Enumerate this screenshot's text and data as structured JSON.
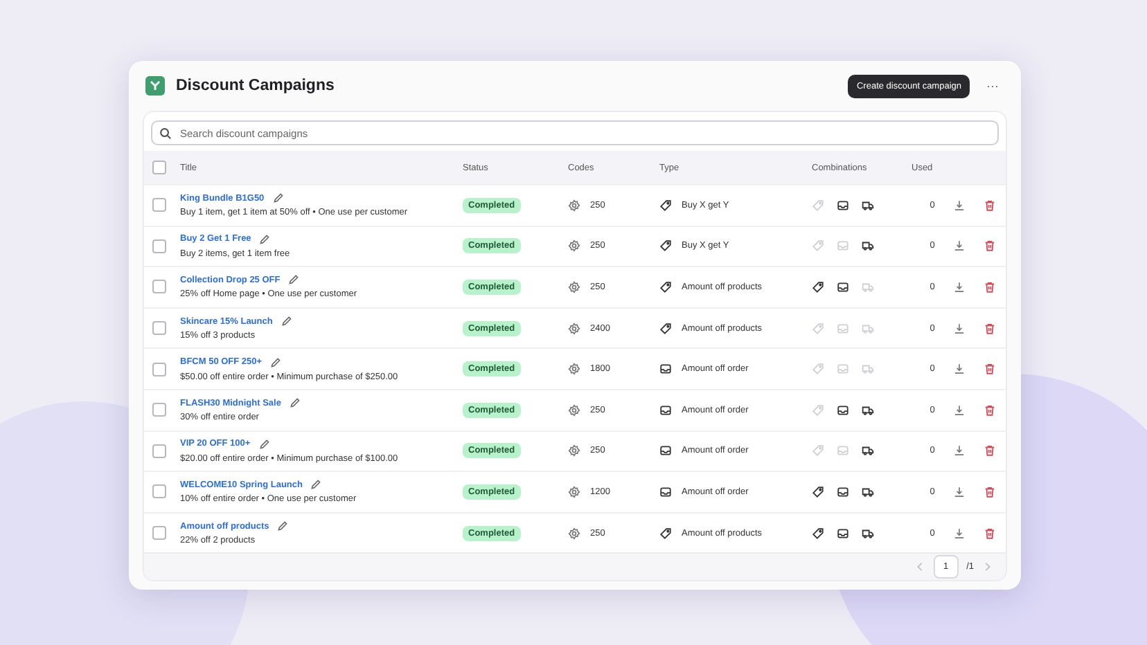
{
  "header": {
    "title": "Discount Campaigns",
    "create_button": "Create discount campaign",
    "more_button": "···"
  },
  "search": {
    "placeholder": "Search discount campaigns"
  },
  "table": {
    "select_all": false,
    "columns": [
      "Title",
      "Status",
      "Codes",
      "Type",
      "Combinations",
      "Used"
    ],
    "rows": [
      {
        "title": "King Bundle B1G50",
        "subtitle": "Buy 1 item, get 1 item at 50% off • One use per customer",
        "status": "Completed",
        "codes": "250",
        "type": "Buy X get Y",
        "kind": "product",
        "combinations": {
          "product": false,
          "order": true,
          "shipping": true
        },
        "used": "0",
        "selected": false
      },
      {
        "title": "Buy 2 Get 1 Free",
        "subtitle": "Buy 2 items, get 1 item free",
        "status": "Completed",
        "codes": "250",
        "type": "Buy X get Y",
        "kind": "product",
        "combinations": {
          "product": false,
          "order": false,
          "shipping": true
        },
        "used": "0",
        "selected": false
      },
      {
        "title": "Collection Drop 25 OFF",
        "subtitle": "25% off Home page • One use per customer",
        "status": "Completed",
        "codes": "250",
        "type": "Amount off products",
        "kind": "product",
        "combinations": {
          "product": true,
          "order": true,
          "shipping": false
        },
        "used": "0",
        "selected": false
      },
      {
        "title": "Skincare 15% Launch",
        "subtitle": "15% off 3 products",
        "status": "Completed",
        "codes": "2400",
        "type": "Amount off products",
        "kind": "product",
        "combinations": {
          "product": false,
          "order": false,
          "shipping": false
        },
        "used": "0",
        "selected": false
      },
      {
        "title": "BFCM 50 OFF 250+",
        "subtitle": "$50.00 off entire order • Minimum purchase of $250.00",
        "status": "Completed",
        "codes": "1800",
        "type": "Amount off order",
        "kind": "order",
        "combinations": {
          "product": false,
          "order": false,
          "shipping": false
        },
        "used": "0",
        "selected": false
      },
      {
        "title": "FLASH30 Midnight Sale",
        "subtitle": "30% off entire order",
        "status": "Completed",
        "codes": "250",
        "type": "Amount off order",
        "kind": "order",
        "combinations": {
          "product": false,
          "order": true,
          "shipping": true
        },
        "used": "0",
        "selected": false
      },
      {
        "title": "VIP 20 OFF 100+",
        "subtitle": "$20.00 off entire order • Minimum purchase of $100.00",
        "status": "Completed",
        "codes": "250",
        "type": "Amount off order",
        "kind": "order",
        "combinations": {
          "product": false,
          "order": false,
          "shipping": true
        },
        "used": "0",
        "selected": false
      },
      {
        "title": "WELCOME10 Spring Launch",
        "subtitle": "10% off entire order • One use per customer",
        "status": "Completed",
        "codes": "1200",
        "type": "Amount off order",
        "kind": "order",
        "combinations": {
          "product": true,
          "order": true,
          "shipping": true
        },
        "used": "0",
        "selected": false
      },
      {
        "title": "Amount off products",
        "subtitle": "22% off 2 products",
        "status": "Completed",
        "codes": "250",
        "type": "Amount off products",
        "kind": "product",
        "combinations": {
          "product": true,
          "order": true,
          "shipping": true
        },
        "used": "0",
        "selected": false
      }
    ]
  },
  "pagination": {
    "page": "1",
    "total": "/1"
  }
}
